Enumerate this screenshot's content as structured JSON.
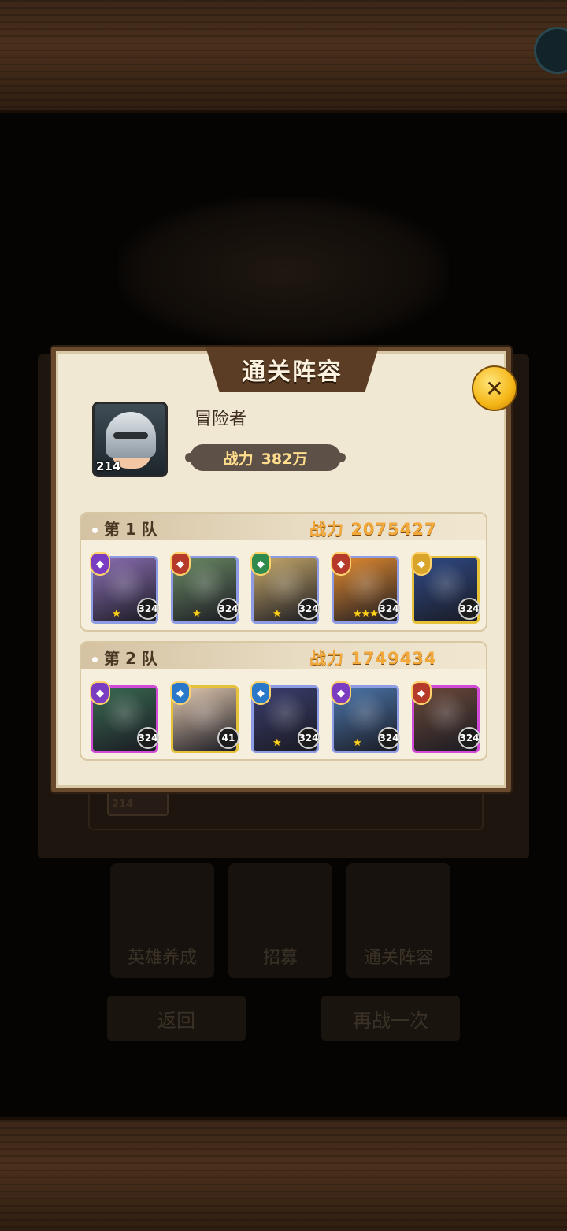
{
  "background": {
    "tiles": [
      "英雄养成",
      "招募",
      "通关阵容"
    ],
    "back_button": "返回",
    "retry_button": "再战一次",
    "card_level": "214"
  },
  "panel": {
    "title": "通关阵容",
    "player_name": "冒险者",
    "player_level": "214",
    "power_label": "战力",
    "power_value": "382万"
  },
  "teams": [
    {
      "label": "第 1 队",
      "power_label": "战力",
      "power_value": "2075427",
      "heroes": [
        {
          "level": "324",
          "stars": 1,
          "frame": "#8e9ce6",
          "art": "#8b6fb3",
          "faction": "#7a3dc2"
        },
        {
          "level": "324",
          "stars": 1,
          "frame": "#8e9ce6",
          "art": "#6b8a64",
          "faction": "#b63a2a"
        },
        {
          "level": "324",
          "stars": 1,
          "frame": "#8e9ce6",
          "art": "#c7a96a",
          "faction": "#2f8a4e"
        },
        {
          "level": "324",
          "stars": 3,
          "frame": "#8e9ce6",
          "art": "#e38b2f",
          "faction": "#b63a2a"
        },
        {
          "level": "324",
          "stars": 0,
          "frame": "#e6c23a",
          "art": "#2f4a86",
          "faction": "#d9a42a"
        }
      ]
    },
    {
      "label": "第 2 队",
      "power_label": "战力",
      "power_value": "1749434",
      "heroes": [
        {
          "level": "324",
          "stars": 0,
          "frame": "#d24ad8",
          "art": "#3a6a52",
          "faction": "#7a3dc2"
        },
        {
          "level": "41",
          "stars": 0,
          "frame": "#e6c23a",
          "art": "#e3c9b0",
          "faction": "#2a78c9"
        },
        {
          "level": "324",
          "stars": 1,
          "frame": "#8e9ce6",
          "art": "#3a3e6e",
          "faction": "#2a78c9"
        },
        {
          "level": "324",
          "stars": 1,
          "frame": "#8e9ce6",
          "art": "#4c77ad",
          "faction": "#7a3dc2"
        },
        {
          "level": "324",
          "stars": 0,
          "frame": "#d24ad8",
          "art": "#6c4a3a",
          "faction": "#b63a2a"
        }
      ]
    }
  ]
}
